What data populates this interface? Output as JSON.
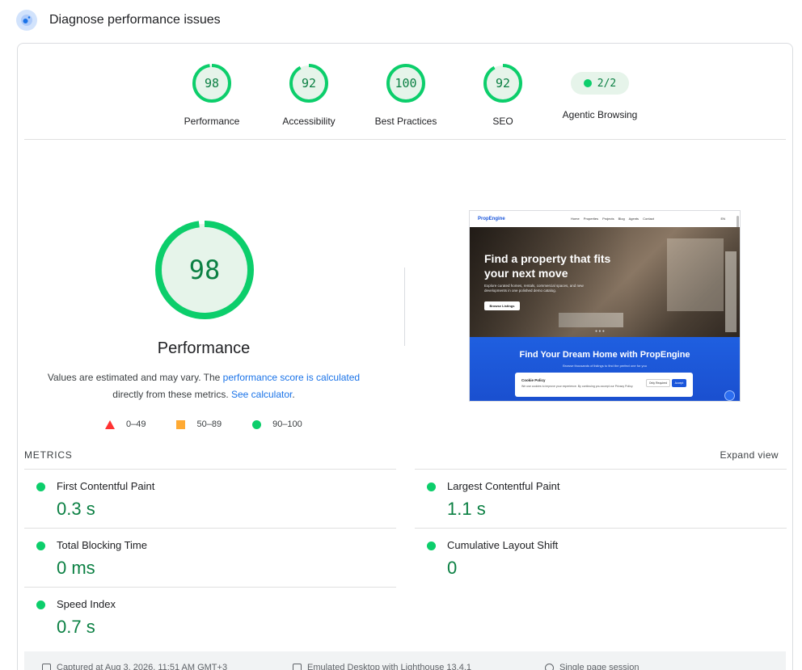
{
  "header": {
    "title": "Diagnose performance issues",
    "icon": "lighthouse-icon"
  },
  "categories": [
    {
      "score": "98",
      "label": "Performance",
      "value": 0.98
    },
    {
      "score": "92",
      "label": "Accessibility",
      "value": 0.92
    },
    {
      "score": "100",
      "label": "Best Practices",
      "value": 1.0
    },
    {
      "score": "92",
      "label": "SEO",
      "value": 0.92
    }
  ],
  "agentic": {
    "score": "2/2",
    "label": "Agentic Browsing"
  },
  "main": {
    "score": "98",
    "value": 0.98,
    "title": "Performance",
    "desc_1": "Values are estimated and may vary. The ",
    "desc_link_1": "performance score is calculated",
    "desc_2": "directly from these metrics. ",
    "desc_link_2": "See calculator",
    "desc_3": "."
  },
  "legend": [
    {
      "label": "0–49",
      "shape": "triangle",
      "color": "#ff3333"
    },
    {
      "label": "50–89",
      "shape": "square",
      "color": "#ffaa33"
    },
    {
      "label": "90–100",
      "shape": "circle",
      "color": "#0cce6b"
    }
  ],
  "screenshot": {
    "logo": "PropEngine",
    "nav_links": "Home Properties Projects Blog Agents Contact",
    "nav_right": "EN",
    "hero_title": "Find a property that fits your next move",
    "hero_desc": "Explore curated homes, rentals, commercial spaces, and new developments in one polished demo catalog.",
    "hero_button": "Browse Listings",
    "section_title": "Find Your Dream Home with PropEngine",
    "section_sub": "Browse thousands of listings to find the perfect one for you",
    "cookie_title": "Cookie Policy",
    "cookie_desc": "We use cookies to improve your experience. By continuing you accept our Privacy Policy.",
    "cookie_btn_1": "Only Required",
    "cookie_btn_2": "Accept"
  },
  "metrics": {
    "title": "METRICS",
    "expand": "Expand view",
    "items": [
      {
        "name": "First Contentful Paint",
        "value": "0.3 s"
      },
      {
        "name": "Largest Contentful Paint",
        "value": "1.1 s"
      },
      {
        "name": "Total Blocking Time",
        "value": "0 ms"
      },
      {
        "name": "Cumulative Layout Shift",
        "value": "0"
      },
      {
        "name": "Speed Index",
        "value": "0.7 s"
      }
    ]
  },
  "infobar": {
    "captured": "Captured at Aug 3, 2026, 11:51 AM GMT+3",
    "emulated": "Emulated Desktop with Lighthouse 13.4.1",
    "session": "Single page session"
  },
  "colors": {
    "pass": "#0cce6b",
    "pass_text": "#0b8043",
    "pass_bg": "#e6f4ea",
    "link": "#1a73e8"
  }
}
